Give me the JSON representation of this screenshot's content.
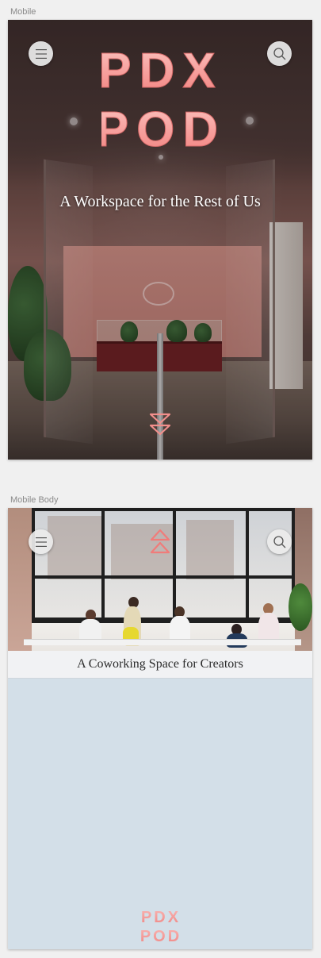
{
  "artboards": [
    {
      "label": "Mobile"
    },
    {
      "label": "Mobile Body"
    }
  ],
  "hero": {
    "logo_line1": "PDX",
    "logo_line2": "POD",
    "tagline": "A Workspace for the Rest of Us",
    "menu_icon": "hamburger-icon",
    "search_icon": "search-icon",
    "scroll_icon": "double-chevron-down-icon"
  },
  "body": {
    "caption": "A Coworking Space for Creators",
    "menu_icon": "hamburger-icon",
    "search_icon": "search-icon",
    "top_icon": "double-chevron-up-icon",
    "footer_logo_line1": "PDX",
    "footer_logo_line2": "POD"
  },
  "colors": {
    "brand_pink": "#f5908f",
    "brand_pink_light": "#f9b8b5",
    "body_background": "#d3dfe8"
  }
}
